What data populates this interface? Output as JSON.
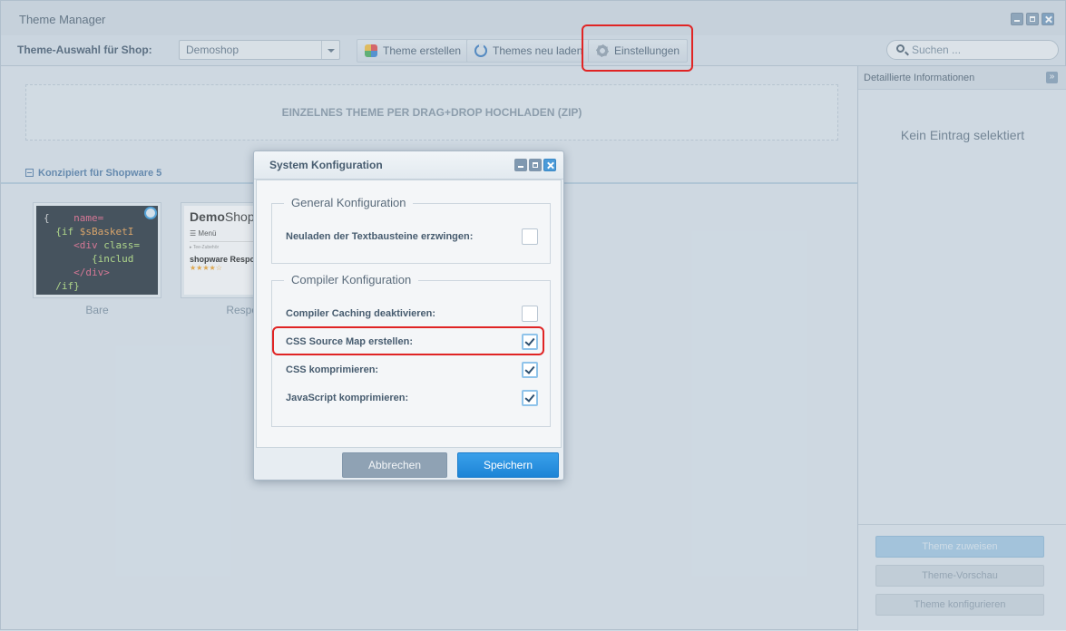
{
  "window": {
    "title": "Theme Manager"
  },
  "toolbar": {
    "shop_label": "Theme-Auswahl für Shop:",
    "shop_value": "Demoshop",
    "create_label": "Theme erstellen",
    "reload_label": "Themes neu laden",
    "settings_label": "Einstellungen",
    "search_placeholder": "Suchen ..."
  },
  "main": {
    "dropzone": "EINZELNES THEME PER DRAG+DROP HOCHLADEN (ZIP)",
    "group_title": "Konzipiert für Shopware 5",
    "themes": [
      {
        "name": "Bare"
      },
      {
        "name": "Respon"
      }
    ],
    "shop_preview": {
      "logo_a": "Demo",
      "logo_b": "Shop",
      "menu": "Menü",
      "crumb": "Tee-Zubehör",
      "product": "shopware Respo",
      "stars": "★★★★☆"
    }
  },
  "side": {
    "header": "Detaillierte Informationen",
    "empty": "Kein Eintrag selektiert",
    "assign_label": "Theme zuweisen",
    "preview_label": "Theme-Vorschau",
    "configure_label": "Theme konfigurieren"
  },
  "dialog": {
    "title": "System Konfiguration",
    "general": {
      "legend": "General Konfiguration",
      "rows": [
        {
          "label": "Neuladen der Textbausteine erzwingen:",
          "checked": false
        }
      ]
    },
    "compiler": {
      "legend": "Compiler Konfiguration",
      "rows": [
        {
          "label": "Compiler Caching deaktivieren:",
          "checked": false
        },
        {
          "label": "CSS Source Map erstellen:",
          "checked": true
        },
        {
          "label": "CSS komprimieren:",
          "checked": true
        },
        {
          "label": "JavaScript komprimieren:",
          "checked": true
        }
      ]
    },
    "cancel_label": "Abbrechen",
    "save_label": "Speichern"
  },
  "colors": {
    "accent": "#1d84d6",
    "highlight": "#e02424",
    "group_title": "#5f86ae"
  }
}
